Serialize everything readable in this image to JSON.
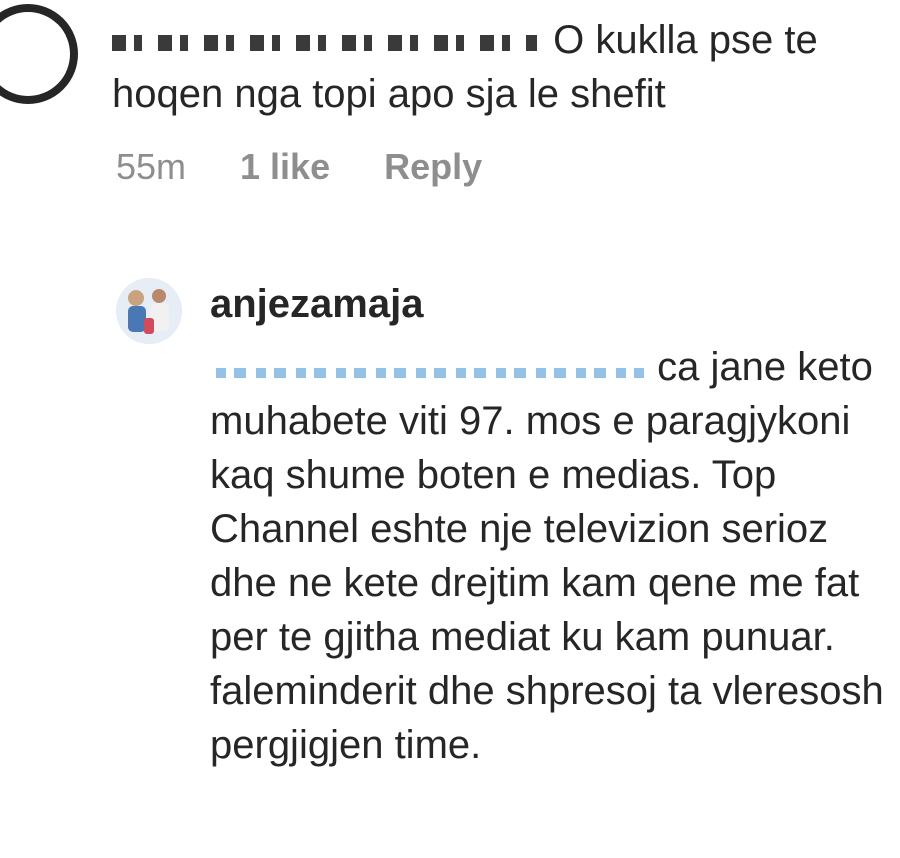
{
  "comment": {
    "username_obscured": "",
    "text": "O kuklla pse te hoqen nga topi apo sja le shefit",
    "time": "55m",
    "likes": "1 like",
    "reply_label": "Reply"
  },
  "reply": {
    "username": "anjezamaja",
    "mention_obscured": "",
    "text": "ca jane keto muhabete viti 97. mos e paragjykoni kaq shume boten e medias. Top Channel eshte nje televizion serioz dhe ne kete drejtim kam qene me fat per te gjitha mediat ku kam punuar. faleminderit dhe shpresoj ta vleresosh pergjigjen time."
  },
  "colors": {
    "text": "#262626",
    "meta": "#8e8e8e",
    "mention": "#3897f0"
  }
}
